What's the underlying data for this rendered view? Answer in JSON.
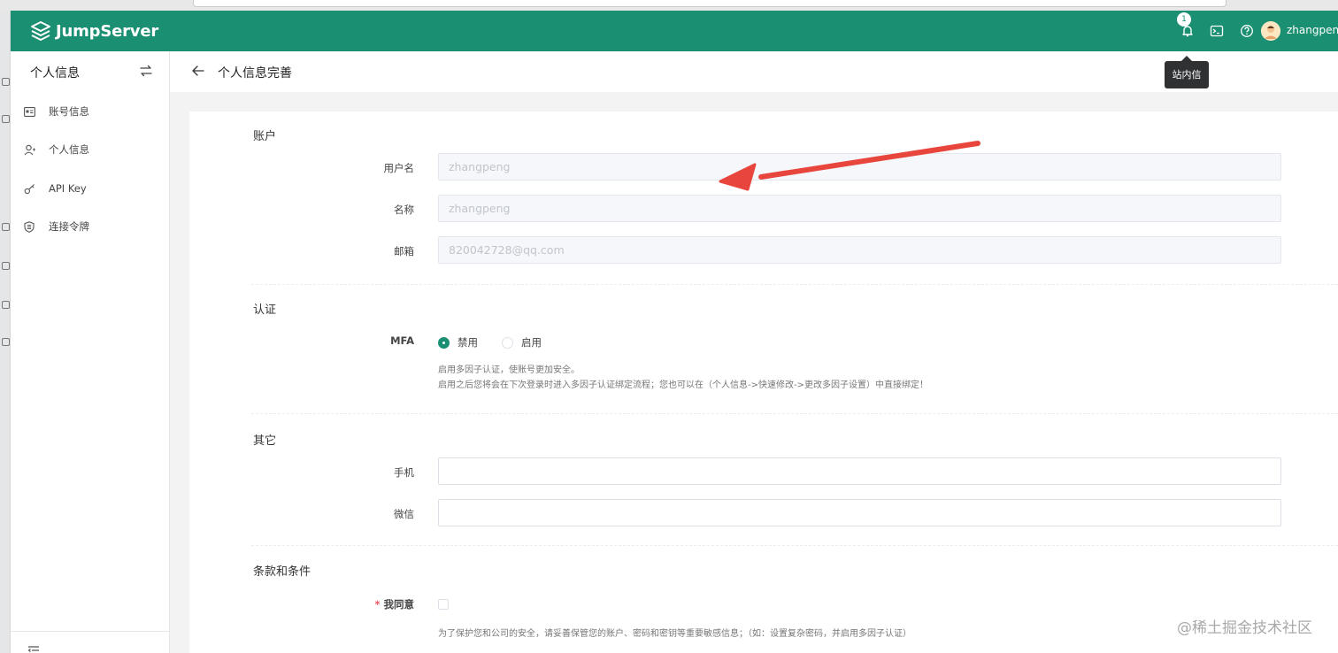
{
  "header": {
    "brand": "JumpServer",
    "notification_count": "1",
    "username": "zhangpeng",
    "tooltip": "站内信"
  },
  "sidebar": {
    "title": "个人信息",
    "items": [
      {
        "label": "账号信息",
        "icon": "id-card-icon"
      },
      {
        "label": "个人信息",
        "icon": "user-icon"
      },
      {
        "label": "API Key",
        "icon": "key-icon"
      },
      {
        "label": "连接令牌",
        "icon": "shield-icon"
      }
    ]
  },
  "page": {
    "title": "个人信息完善"
  },
  "form": {
    "account": {
      "title": "账户",
      "username_label": "用户名",
      "username_value": "zhangpeng",
      "name_label": "名称",
      "name_value": "zhangpeng",
      "email_label": "邮箱",
      "email_value": "820042728@qq.com"
    },
    "auth": {
      "title": "认证",
      "mfa_label": "MFA",
      "option_disable": "禁用",
      "option_enable": "启用",
      "selected": "禁用",
      "help_line1": "启用多因子认证，使账号更加安全。",
      "help_line2": "启用之后您将会在下次登录时进入多因子认证绑定流程；您也可以在（个人信息->快速修改->更改多因子设置）中直接绑定！"
    },
    "other": {
      "title": "其它",
      "phone_label": "手机",
      "phone_value": "",
      "wechat_label": "微信",
      "wechat_value": ""
    },
    "terms": {
      "title": "条款和条件",
      "required_mark": "*",
      "agree_label": "我同意",
      "agree_checked": false,
      "help": "为了保护您和公司的安全，请妥善保管您的账户、密码和密钥等重要敏感信息；（如：设置复杂密码，并启用多因子认证）"
    }
  },
  "watermark": "@稀土掘金技术社区",
  "colors": {
    "brand": "#1a8f72",
    "annotation_arrow": "#e8453c"
  }
}
